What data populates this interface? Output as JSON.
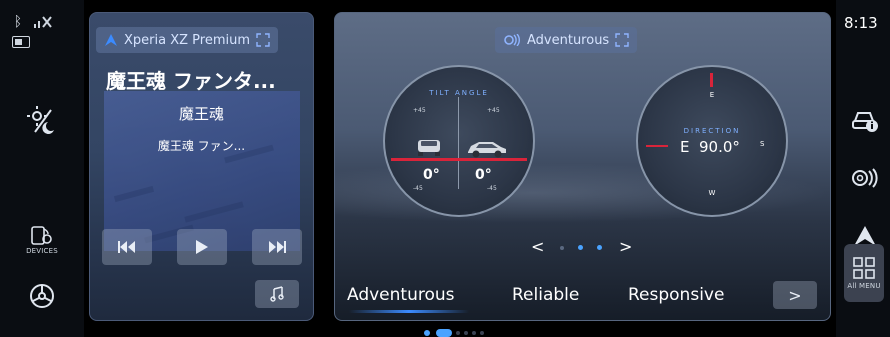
{
  "status": {
    "time": "8:13"
  },
  "left_rail": {
    "devices_label": "DEVICES"
  },
  "right_rail": {
    "all_menu_label": "All MENU"
  },
  "media": {
    "source": "Xperia XZ Premium",
    "track_title": "魔王魂 ファンタ...",
    "artist": "魔王魂",
    "album": "魔王魂 ファン..."
  },
  "drive": {
    "mode_chip": "Adventurous",
    "tilt": {
      "label": "TILT ANGLE",
      "tick_pos": "+45",
      "tick_neg": "-45",
      "pitch_value": "0°",
      "roll_value": "0°"
    },
    "compass": {
      "label": "DIRECTION",
      "reading": "E  90.0°",
      "n": "E",
      "s": "W",
      "e": "S"
    },
    "modes": [
      "Adventurous",
      "Reliable",
      "Responsive"
    ],
    "next_label": ">",
    "prev_label": "<"
  },
  "colors": {
    "accent": "#3b8bff",
    "indicator": "#d9243a",
    "page_dot": "#4aa3ff"
  }
}
